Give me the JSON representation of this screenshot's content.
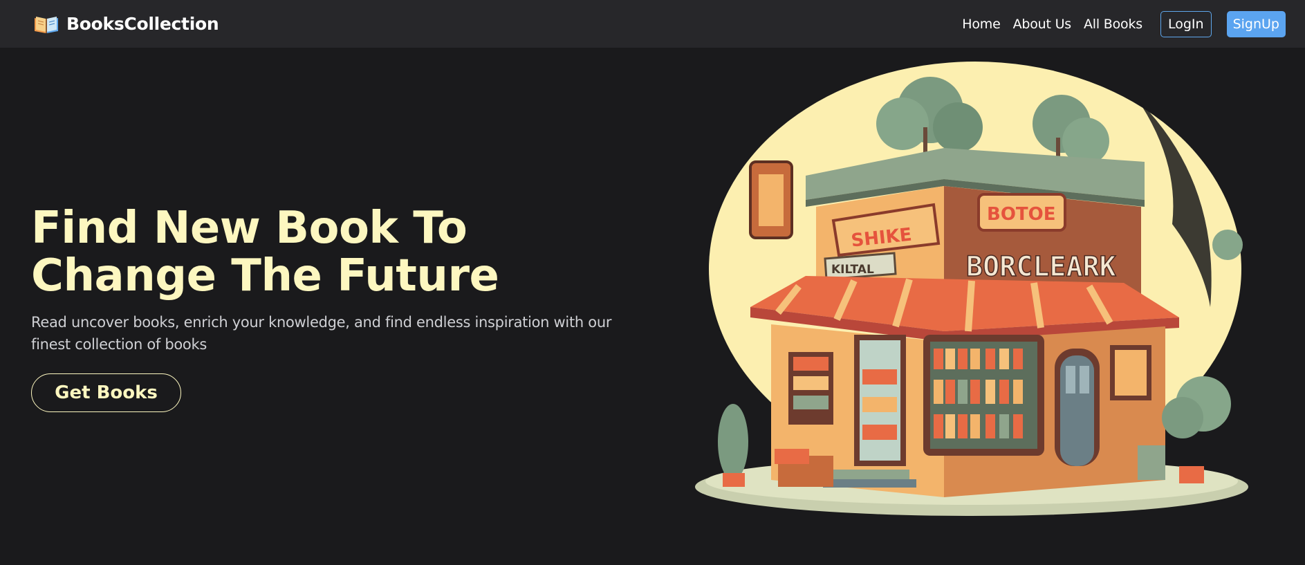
{
  "nav": {
    "brand": "BooksCollection",
    "links": [
      "Home",
      "About Us",
      "All Books"
    ],
    "login_label": "LogIn",
    "signup_label": "SignUp"
  },
  "hero": {
    "title": "Find New Book To Change The Future",
    "subtitle": "Read uncover books, enrich your knowledge, and find endless inspiration with our finest collection of books",
    "cta_label": "Get Books"
  },
  "illustration": {
    "signs": [
      "SHIKE",
      "BOTOE",
      "KILTAL",
      "BORCLEARK"
    ]
  },
  "colors": {
    "background": "#1a1a1c",
    "navbar": "#27272a",
    "accent_cream": "#fdf7c0",
    "signup_blue": "#5ba4f0",
    "login_border": "#5fa8ee"
  },
  "icons": {
    "brand": "open-book-icon"
  }
}
